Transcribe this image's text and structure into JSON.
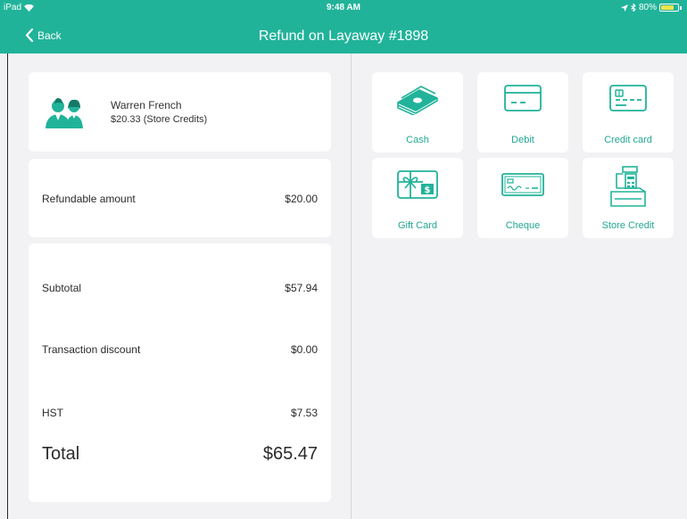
{
  "status_bar": {
    "device": "iPad",
    "time": "9:48 AM",
    "battery": "80%",
    "battery_level": 0.8
  },
  "header": {
    "back_label": "Back",
    "title": "Refund on Layaway #1898"
  },
  "customer": {
    "name": "Warren French",
    "credits": "$20.33  (Store Credits)"
  },
  "refund": {
    "label": "Refundable amount",
    "value": "$20.00"
  },
  "totals": {
    "subtotal_label": "Subtotal",
    "subtotal_value": "$57.94",
    "discount_label": "Transaction discount",
    "discount_value": "$0.00",
    "tax_label": "HST",
    "tax_value": "$7.53",
    "total_label": "Total",
    "total_value": "$65.47"
  },
  "payment_methods": [
    {
      "label": "Cash",
      "icon": "cash-icon"
    },
    {
      "label": "Debit",
      "icon": "debit-card-icon"
    },
    {
      "label": "Credit card",
      "icon": "credit-card-icon"
    },
    {
      "label": "Gift Card",
      "icon": "gift-card-icon"
    },
    {
      "label": "Cheque",
      "icon": "cheque-icon"
    },
    {
      "label": "Store Credit",
      "icon": "cash-register-icon"
    }
  ],
  "colors": {
    "accent": "#21b39a",
    "background": "#f2f2f4",
    "card": "#ffffff"
  }
}
